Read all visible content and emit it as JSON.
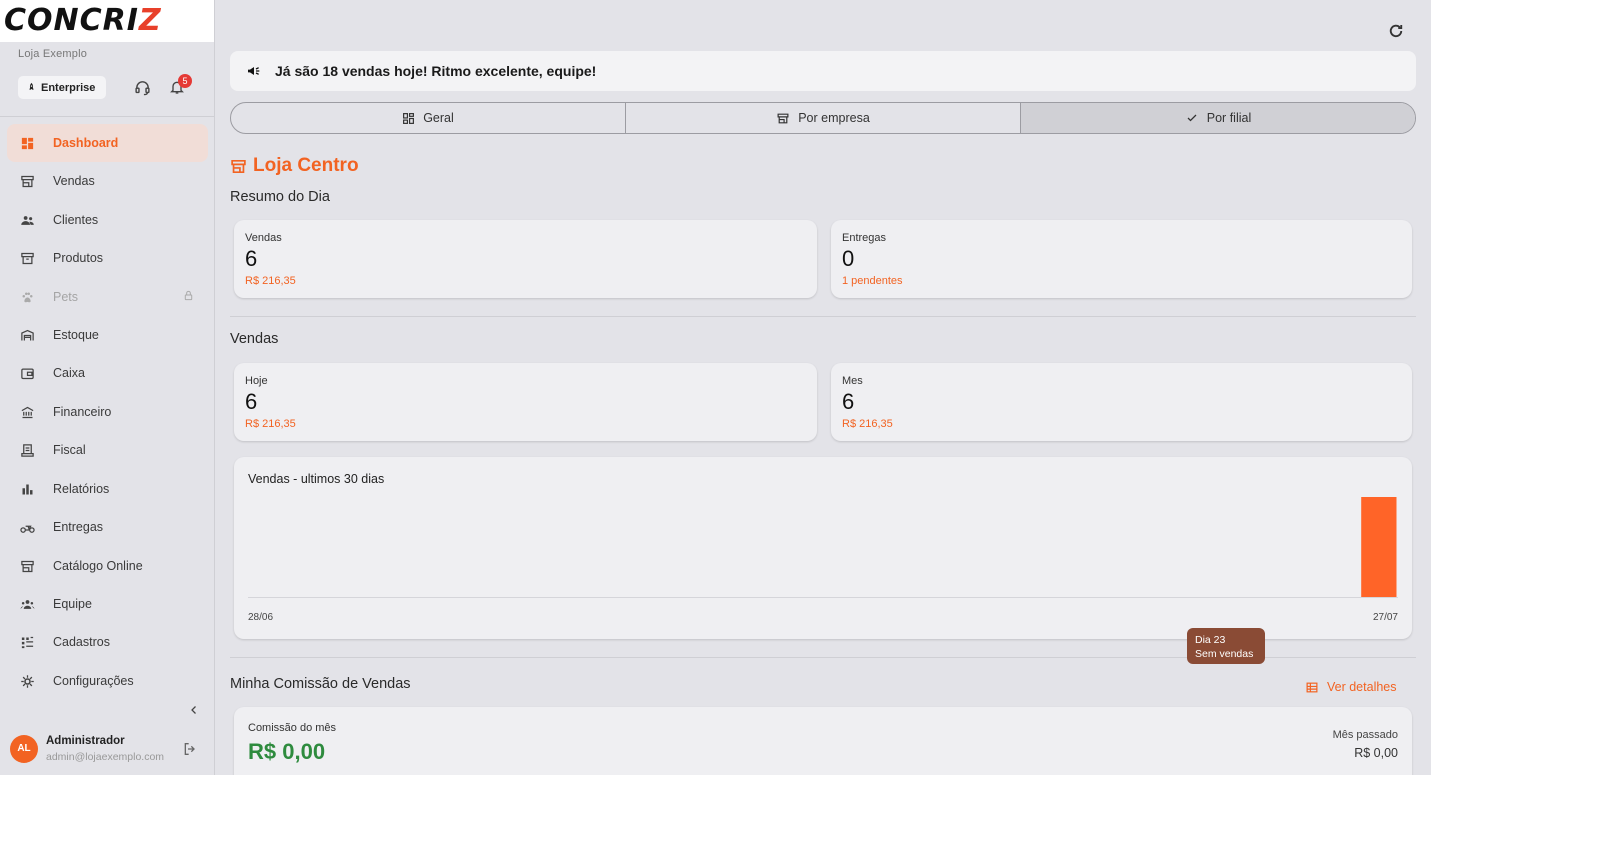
{
  "app": {
    "logo_main": "CONCRI",
    "logo_accent": "Z",
    "store": "Loja Exemplo",
    "plan": "Enterprise",
    "notifications": "5"
  },
  "sidebar": {
    "items": [
      {
        "label": "Dashboard",
        "icon": "dashboard-icon",
        "active": true
      },
      {
        "label": "Vendas",
        "icon": "store-icon"
      },
      {
        "label": "Clientes",
        "icon": "people-icon"
      },
      {
        "label": "Produtos",
        "icon": "archive-icon"
      },
      {
        "label": "Pets",
        "icon": "paw-icon",
        "locked": true
      },
      {
        "label": "Estoque",
        "icon": "warehouse-icon"
      },
      {
        "label": "Caixa",
        "icon": "wallet-icon"
      },
      {
        "label": "Financeiro",
        "icon": "bank-icon"
      },
      {
        "label": "Fiscal",
        "icon": "receipt-icon"
      },
      {
        "label": "Relatórios",
        "icon": "bar-chart-icon"
      },
      {
        "label": "Entregas",
        "icon": "motorcycle-icon"
      },
      {
        "label": "Catálogo Online",
        "icon": "storefront-icon"
      },
      {
        "label": "Equipe",
        "icon": "groups-icon"
      },
      {
        "label": "Cadastros",
        "icon": "grid-list-icon"
      },
      {
        "label": "Configurações",
        "icon": "gear-icon"
      }
    ]
  },
  "user": {
    "initials": "AL",
    "name": "Administrador",
    "email": "admin@lojaexemplo.com"
  },
  "banner": "Já são 18 vendas hoje! Ritmo excelente, equipe!",
  "tabs": [
    {
      "label": "Geral",
      "icon": "grid-icon"
    },
    {
      "label": "Por empresa",
      "icon": "store-icon"
    },
    {
      "label": "Por filial",
      "icon": "check-icon",
      "selected": true
    }
  ],
  "branch": "Loja Centro",
  "summary": {
    "title": "Resumo do Dia",
    "sales": {
      "label": "Vendas",
      "value": "6",
      "sub": "R$ 216,35"
    },
    "deliveries": {
      "label": "Entregas",
      "value": "0",
      "sub": "1 pendentes"
    }
  },
  "sales": {
    "title": "Vendas",
    "today": {
      "label": "Hoje",
      "value": "6",
      "sub": "R$ 216,35"
    },
    "month": {
      "label": "Mes",
      "value": "6",
      "sub": "R$ 216,35"
    }
  },
  "chart_data": {
    "type": "bar",
    "title": "Vendas - ultimos 30 dias",
    "x_start": "28/06",
    "x_end": "27/07",
    "values": [
      0,
      0,
      0,
      0,
      0,
      0,
      0,
      0,
      0,
      0,
      0,
      0,
      0,
      0,
      0,
      0,
      0,
      0,
      0,
      0,
      0,
      0,
      0,
      0,
      0,
      0,
      0,
      0,
      0,
      6
    ],
    "color": "#ff6428",
    "tooltip": {
      "line1": "Dia 23",
      "line2": "Sem vendas"
    }
  },
  "commission": {
    "title": "Minha Comissão de Vendas",
    "details": "Ver detalhes",
    "month_label": "Comissão do mês",
    "month_value": "R$ 0,00",
    "prev_label": "Mês passado",
    "prev_value": "R$ 0,00"
  }
}
